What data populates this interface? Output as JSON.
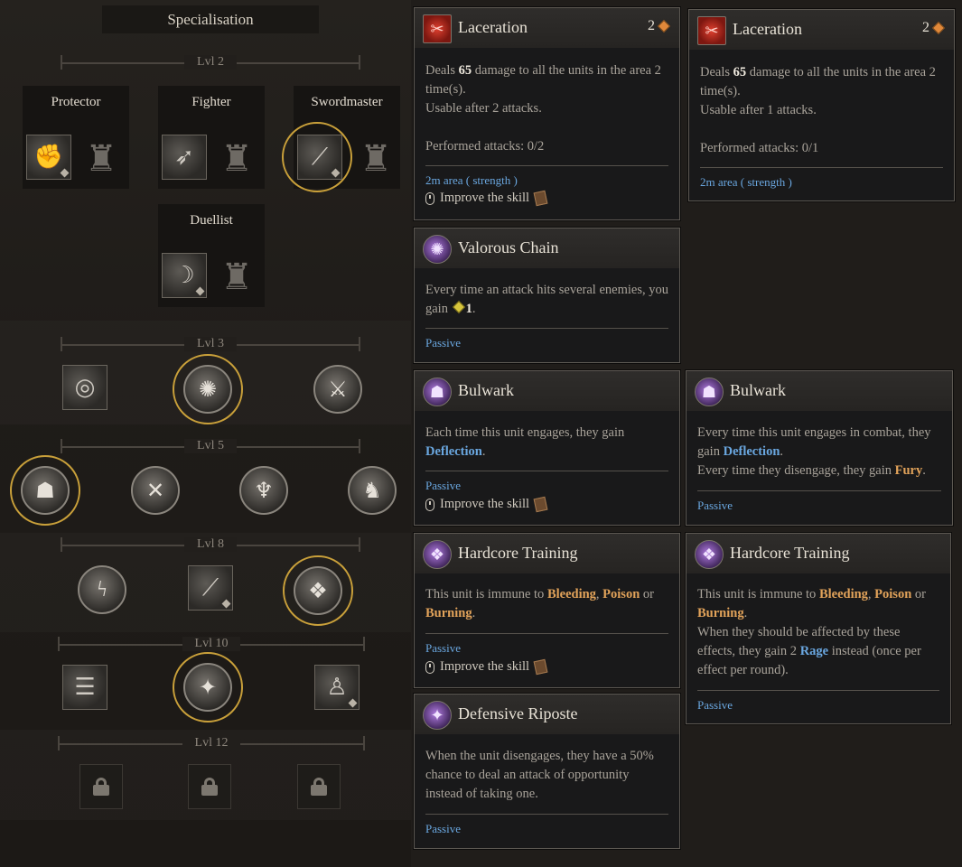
{
  "panel": {
    "title": "Specialisation"
  },
  "levels": {
    "l2": "Lvl 2",
    "l3": "Lvl 3",
    "l5": "Lvl 5",
    "l8": "Lvl 8",
    "l10": "Lvl 10",
    "l12": "Lvl 12"
  },
  "classes": [
    {
      "name": "Protector"
    },
    {
      "name": "Fighter"
    },
    {
      "name": "Swordmaster"
    },
    {
      "name": "Duellist"
    }
  ],
  "icons": {
    "class_skill": [
      "shield-bash-icon",
      "kick-icon",
      "sword-slash-icon",
      "blade-sweep-icon"
    ],
    "armor": "armor-chest-icon",
    "lvl3": [
      "chain-shield-icon",
      "valorous-chain-icon",
      "crossed-swords-icon"
    ],
    "lvl5": [
      "bulwark-hood-icon",
      "sword-clash-icon",
      "raised-arms-icon",
      "duelist-stance-icon"
    ],
    "lvl8": [
      "lightning-warrior-icon",
      "spear-icon",
      "hardcore-training-icon"
    ],
    "lvl10": [
      "ladder-icon",
      "defensive-riposte-icon",
      "fighter-silhouette-icon"
    ],
    "locked": "lock-icon"
  },
  "selected": {
    "class": "Swordmaster",
    "lvl3": "valorous-chain-icon",
    "lvl5": "bulwark-hood-icon",
    "lvl8": "hardcore-training-icon",
    "lvl10": "defensive-riposte-icon"
  },
  "tooltips": {
    "laceration_a": {
      "title": "Laceration",
      "cost": "2",
      "dmg_pre": "Deals ",
      "dmg_val": "65",
      "dmg_post": " damage to all the units in the area 2 time(s).",
      "usable": "Usable after 2 attacks.",
      "performed": "Performed attacks: 0/2",
      "tag": "2m area ( strength )",
      "improve": "Improve the skill"
    },
    "laceration_b": {
      "title": "Laceration",
      "cost": "2",
      "dmg_pre": "Deals ",
      "dmg_val": "65",
      "dmg_post": " damage to all the units in the area 2 time(s).",
      "usable": "Usable after 1 attacks.",
      "performed": "Performed attacks: 0/1",
      "tag": "2m area ( strength )"
    },
    "valorous_chain": {
      "title": "Valorous Chain",
      "text_pre": "Every time an attack hits several enemies, you gain ",
      "gain": "1",
      "text_post": ".",
      "tag": "Passive"
    },
    "bulwark_a": {
      "title": "Bulwark",
      "text_pre": "Each time this unit engages, they gain ",
      "kw": "Deflection",
      "text_post": ".",
      "tag": "Passive",
      "improve": "Improve the skill"
    },
    "bulwark_b": {
      "title": "Bulwark",
      "line1_pre": "Every time this unit engages in combat, they gain ",
      "kw1": "Deflection",
      "line1_post": ".",
      "line2_pre": "Every time they disengage, they gain ",
      "kw2": "Fury",
      "line2_post": ".",
      "tag": "Passive"
    },
    "hardcore_a": {
      "title": "Hardcore Training",
      "text_pre": "This unit is immune to ",
      "kw1": "Bleeding",
      "sep1": ", ",
      "kw2": "Poison",
      "sep2": " or ",
      "kw3": "Burning",
      "text_post": ".",
      "tag": "Passive",
      "improve": "Improve the skill"
    },
    "hardcore_b": {
      "title": "Hardcore Training",
      "text_pre": "This unit is immune to ",
      "kw1": "Bleeding",
      "sep1": ", ",
      "kw2": "Poison",
      "sep2": " or ",
      "kw3": "Burning",
      "text_post": ".",
      "extra_pre": "When they should be affected by these effects, they gain 2 ",
      "kw4": "Rage",
      "extra_post": " instead (once per effect per round).",
      "tag": "Passive"
    },
    "defensive_riposte": {
      "title": "Defensive Riposte",
      "text": "When the unit disengages, they have a 50% chance to deal an attack of opportunity instead of taking one.",
      "tag": "Passive"
    }
  },
  "colors": {
    "keyword_blue": "#6aa7e0",
    "keyword_orange": "#e2a35a",
    "selected_ring": "#c9a03a",
    "cost_diamond": "#e0883a",
    "gain_diamond": "#d7c53c"
  }
}
